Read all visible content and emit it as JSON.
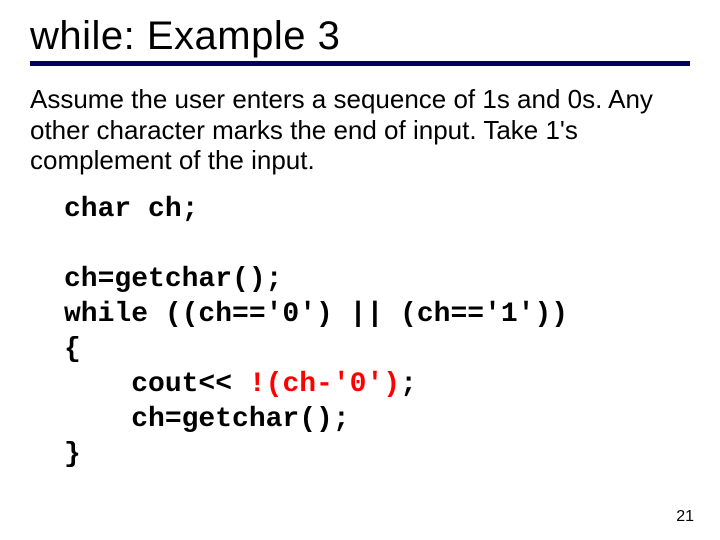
{
  "slide": {
    "title": "while: Example 3",
    "description": "Assume the user enters a sequence of 1s and 0s. Any other character marks the end of input. Take 1's complement of the input.",
    "code": {
      "line1": "char ch;",
      "line2": "",
      "line3": "ch=getchar();",
      "line4": "while ((ch=='0') || (ch=='1'))",
      "line5": "{",
      "line6_prefix": "    cout<< ",
      "line6_red": "!(ch-'0')",
      "line6_suffix": ";",
      "line7": "    ch=getchar();",
      "line8": "}"
    },
    "page_number": "21"
  }
}
